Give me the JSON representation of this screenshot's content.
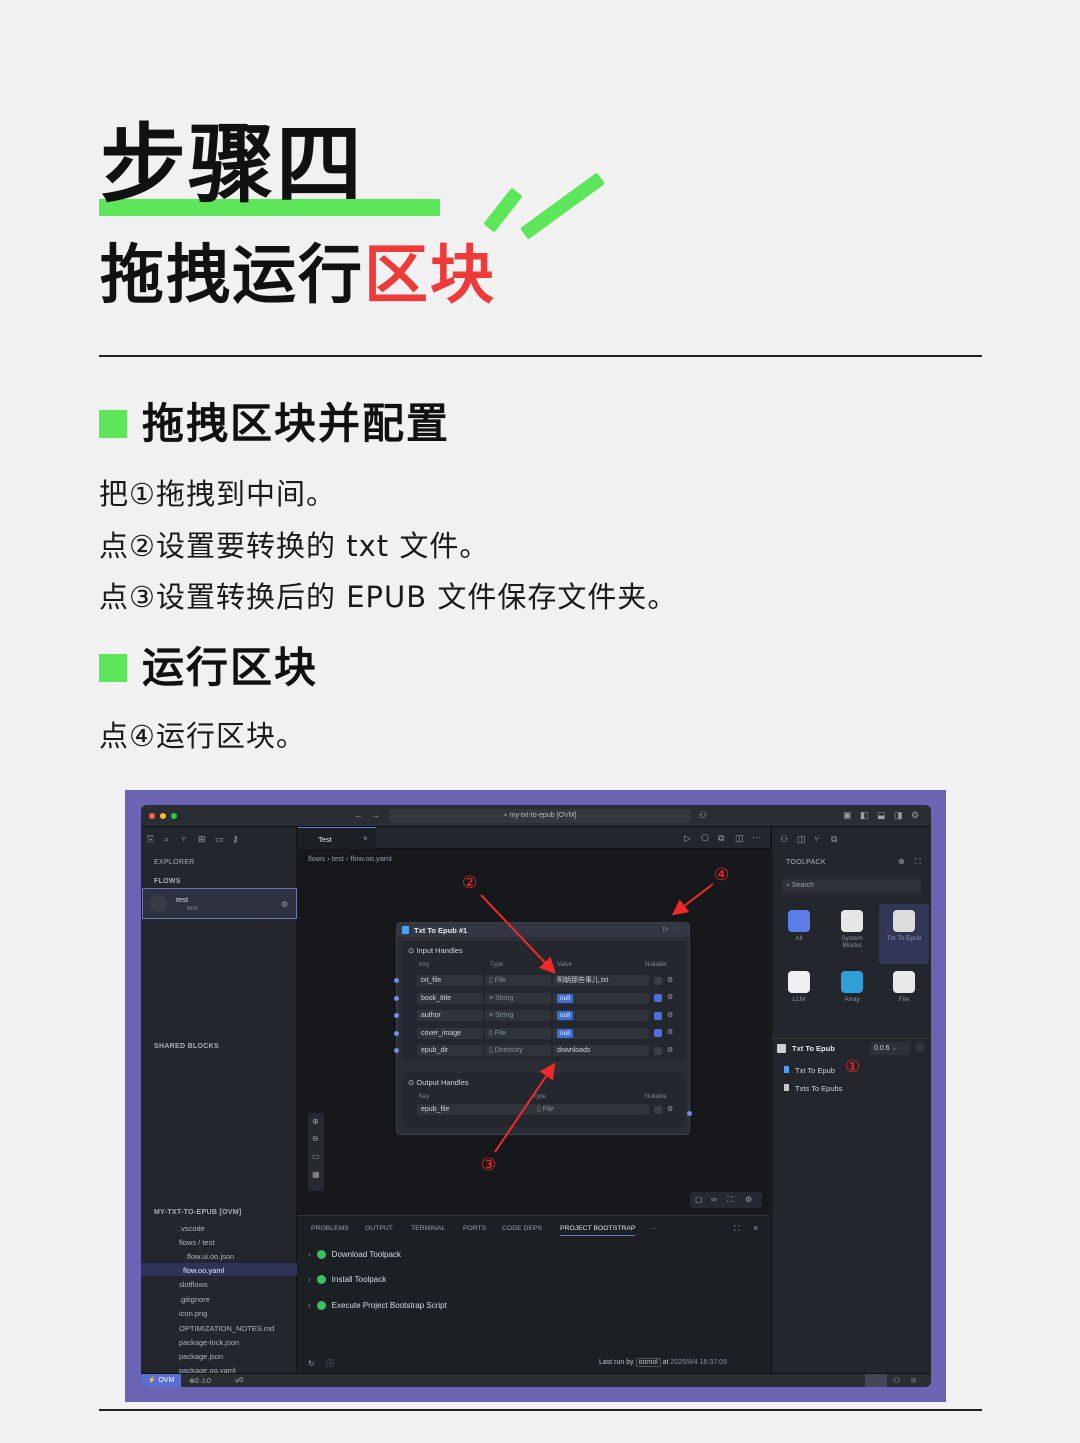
{
  "header": {
    "title": "步骤四",
    "subtitle_prefix": "拖拽运行",
    "subtitle_highlight": "区块",
    "accent_color": "#5ee65a",
    "highlight_color": "#ef3a3a"
  },
  "section1": {
    "heading": "拖拽区块并配置",
    "lines": [
      "把①拖拽到中间。",
      "点②设置要转换的 txt 文件。",
      "点③设置转换后的 EPUB 文件保存文件夹。"
    ]
  },
  "section2": {
    "heading": "运行区块",
    "lines": [
      "点④运行区块。"
    ]
  },
  "ide": {
    "top_search": "my-txt-to-epub [OVM]",
    "sidebar": {
      "explorer_label": "EXPLORER",
      "flows_label": "FLOWS",
      "flow_item_name": "test",
      "flow_item_sub": "test",
      "shared_label": "SHARED BLOCKS",
      "project_label": "MY-TXT-TO-EPUB [OVM]",
      "files": [
        ".vscode",
        "flows / test",
        ".flow.ui.oo.json",
        "flow.oo.yaml",
        "slotflows",
        ".gitignore",
        "icon.png",
        "OPTIMIZATION_NOTES.md",
        "package-lock.json",
        "package.json",
        "package.oo.yaml"
      ]
    },
    "tab_label": "Test",
    "breadcrumb": [
      "flows",
      "test",
      "flow.oo.yaml"
    ],
    "node": {
      "title": "Txt To Epub #1",
      "input_label": "Input Handles",
      "col_key": "Key",
      "col_type": "Type",
      "col_value": "Value",
      "col_nullable": "Nullable",
      "inputs": [
        {
          "key": "txt_file",
          "type": "File",
          "value": "明朝那些事儿.txt",
          "null": false
        },
        {
          "key": "book_title",
          "type": "String",
          "value": "null",
          "null": true
        },
        {
          "key": "author",
          "type": "String",
          "value": "null",
          "null": true
        },
        {
          "key": "cover_image",
          "type": "File",
          "value": "null",
          "null": true
        },
        {
          "key": "epub_dir",
          "type": "Directory",
          "value": "downloads",
          "null": false
        }
      ],
      "output_label": "Output Handles",
      "output_col_type": "Type",
      "outputs": [
        {
          "key": "epub_file",
          "type": "File"
        }
      ]
    },
    "panel": {
      "tabs": [
        "PROBLEMS",
        "OUTPUT",
        "TERMINAL",
        "PORTS",
        "CODE DEPS",
        "PROJECT BOOTSTRAP",
        "···"
      ],
      "rows": [
        "Download Toolpack",
        "Install Toolpack",
        "Execute Project Bootstrap Script"
      ],
      "last_run_prefix": "Last run by",
      "last_run_user": "oomol",
      "last_run_at": "at",
      "last_run_time": "2025/8/4 16:37:09"
    },
    "toolpack": {
      "label": "TOOLPACK",
      "search": "Search",
      "tiles": [
        "All",
        "System Blocks",
        "Txt To Epub",
        "LLM",
        "Array",
        "File"
      ],
      "selected_title": "Txt To Epub",
      "version": "0.0.6",
      "blocks": [
        "Txt To Epub",
        "Txts To Epubs"
      ]
    },
    "status": {
      "branch": "OVM",
      "errors": "0",
      "warnings": "0",
      "ports": "0"
    },
    "annotations": {
      "a1": "①",
      "a2": "②",
      "a3": "③",
      "a4": "④",
      "arrow_color": "#f02a2a"
    }
  }
}
